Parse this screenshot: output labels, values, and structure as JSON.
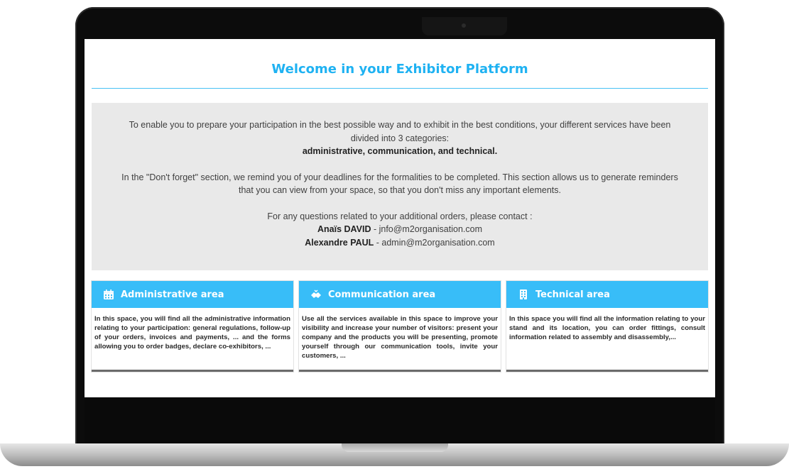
{
  "page": {
    "title": "Welcome in your Exhibitor Platform",
    "intro": {
      "line1": "To enable you to prepare your participation in the best possible way and to exhibit in the best conditions, your different services have been",
      "line2": "divided into 3 categories:",
      "line3": "administrative, communication, and technical.",
      "line4": "In the \"Don't forget\" section, we remind you of your deadlines for the formalities to be completed. This section allows us to generate reminders",
      "line5": "that you can view from your space, so that you don't miss any important elements.",
      "line6": "For any questions related to your additional orders, please contact :",
      "contacts": [
        {
          "name": "Anaïs DAVID",
          "email": " - jnfo@m2organisation.com"
        },
        {
          "name": "Alexandre PAUL",
          "email": " - admin@m2organisation.com"
        }
      ]
    }
  },
  "cards": [
    {
      "icon": "calendar-icon",
      "title": "Administrative area",
      "text": "In this space, you will find all the administrative information relating to your participation: general regulations, follow-up of your orders, invoices and payments, ... and the forms allowing you to order badges, declare co-exhibitors, ..."
    },
    {
      "icon": "handshake-icon",
      "title": "Communication area",
      "text": "Use all the services available in this space to improve your visibility and increase your number of visitors: present your company and the products you will be presenting, promote yourself through our communication tools, invite your customers, ..."
    },
    {
      "icon": "building-icon",
      "title": "Technical area",
      "text": "In this space you will find all the information relating to your stand and its location, you can order fittings, consult information related to assembly and disassembly,..."
    }
  ],
  "colors": {
    "accent": "#1fb2f2",
    "card_header": "#38bdf8",
    "intro_bg": "#e9e9e9"
  }
}
